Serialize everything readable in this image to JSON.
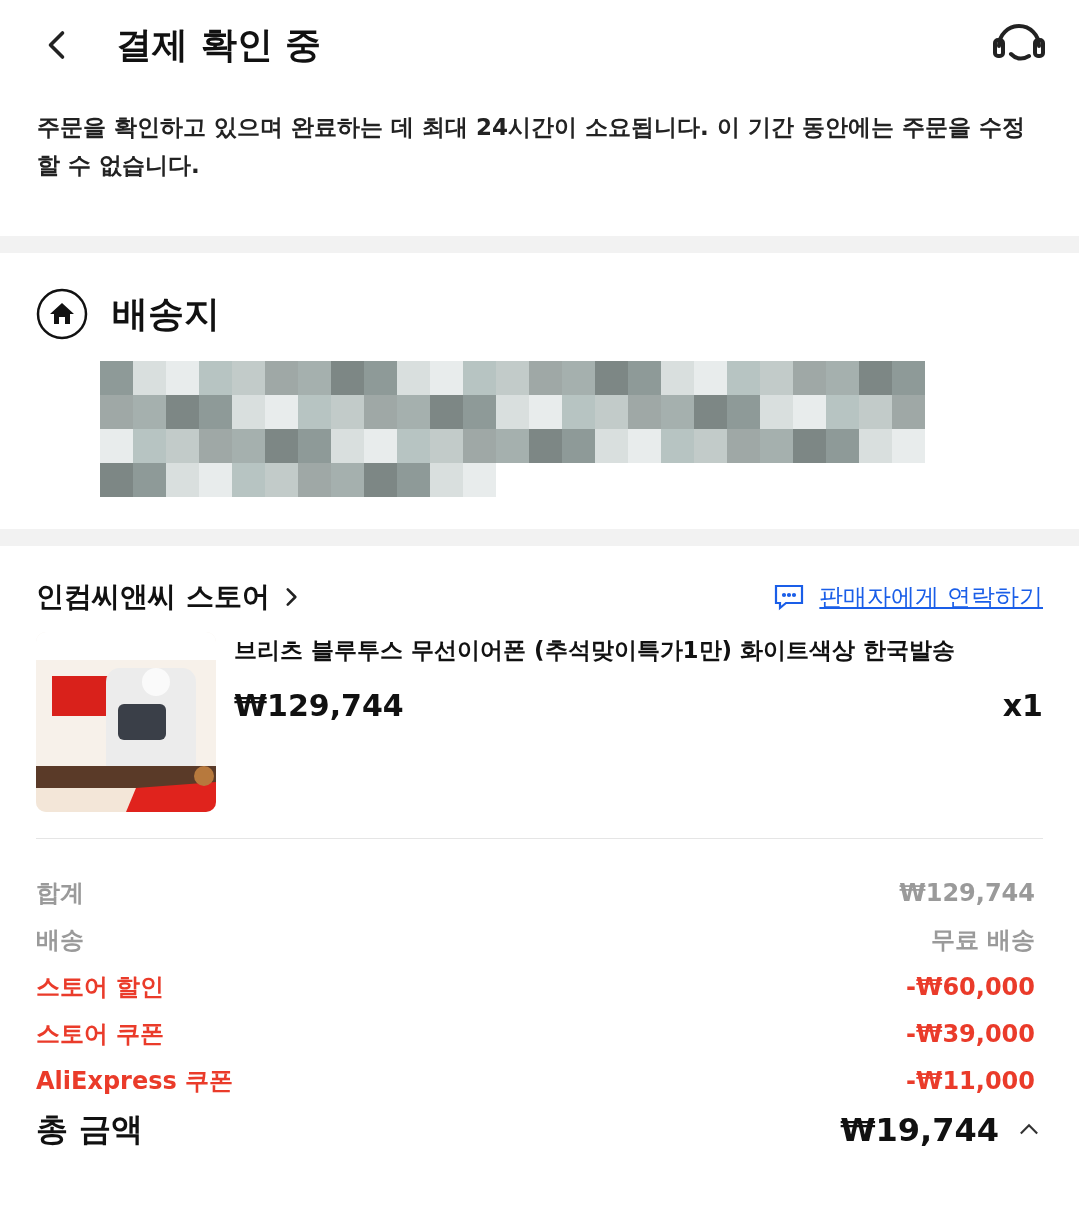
{
  "header": {
    "title": "결제 확인 중"
  },
  "notice": "주문을 확인하고 있으며 완료하는 데 최대 24시간이 소요됩니다. 이 기간 동안에는 주문을 수정할 수 없습니다.",
  "address": {
    "title": "배송지"
  },
  "store": {
    "name": "인컴씨앤씨 스토어",
    "contact_link": "판매자에게 연락하기"
  },
  "product": {
    "title": "브리츠 블루투스 무선이어폰 (추석맞이특가1만) 화이트색상 한국발송",
    "price": "₩129,744",
    "quantity": "x1"
  },
  "summary": [
    {
      "label": "합계",
      "value": "₩129,744",
      "kind": "normal"
    },
    {
      "label": "배송",
      "value": "무료 배송",
      "kind": "normal"
    },
    {
      "label": "스토어 할인",
      "value": "-₩60,000",
      "kind": "discount"
    },
    {
      "label": "스토어 쿠폰",
      "value": "-₩39,000",
      "kind": "discount"
    },
    {
      "label": "AliExpress 쿠폰",
      "value": "-₩11,000",
      "kind": "discount"
    }
  ],
  "total": {
    "label": "총 금액",
    "value": "₩19,744",
    "expanded": true
  }
}
